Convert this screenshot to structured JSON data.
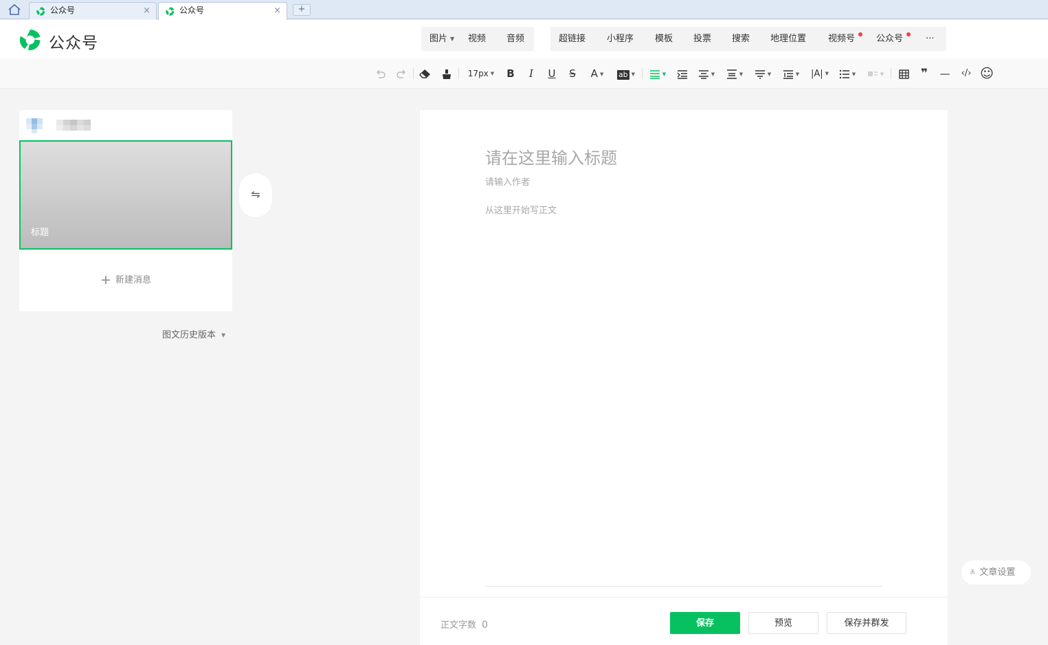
{
  "browser": {
    "tabs": [
      {
        "title": "公众号",
        "close": "×"
      },
      {
        "title": "公众号",
        "close": "×"
      }
    ],
    "new_tab": "+"
  },
  "header": {
    "brand": "公众号",
    "insert_basic": [
      {
        "label": "图片",
        "caret": "▼"
      },
      {
        "label": "视频"
      },
      {
        "label": "音频"
      }
    ],
    "insert_more": [
      {
        "label": "超链接"
      },
      {
        "label": "小程序"
      },
      {
        "label": "模板"
      },
      {
        "label": "投票"
      },
      {
        "label": "搜索"
      },
      {
        "label": "地理位置"
      },
      {
        "label": "视频号"
      },
      {
        "label": "公众号"
      },
      {
        "label": "···"
      }
    ],
    "accent_color": "#07c160",
    "dot_color": "#f0433b"
  },
  "toolbar": {
    "font_size": "17px",
    "bold": "B",
    "italic": "I",
    "underline": "U",
    "strike": "S",
    "font_color": "A",
    "bg_color": "ab",
    "dropdown": "▼",
    "letter_spacing": "|A|",
    "quote": "❞",
    "hr": "—",
    "code": "‹/›",
    "emoji": "☺"
  },
  "left_panel": {
    "cover_title": "标题",
    "new_message": "新建消息",
    "new_message_plus": "+",
    "swap": "⇋",
    "history": "图文历史版本",
    "history_caret": "▼"
  },
  "editor": {
    "title_placeholder": "请在这里输入标题",
    "author_placeholder": "请输入作者",
    "body_placeholder": "从这里开始写正文",
    "word_count_label": "正文字数",
    "word_count": "0",
    "save": "保存",
    "preview": "预览",
    "save_publish": "保存并群发"
  },
  "article_settings": {
    "label": "文章设置",
    "chevron": "≚"
  }
}
